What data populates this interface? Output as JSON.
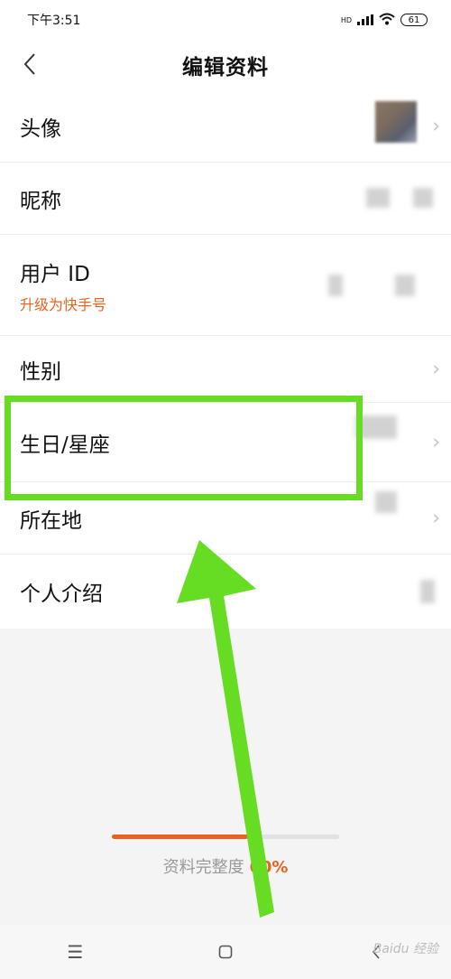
{
  "status_bar": {
    "time": "下午3:51",
    "hd_label": "HD",
    "battery": "61"
  },
  "header": {
    "title": "编辑资料"
  },
  "rows": [
    {
      "label": "头像"
    },
    {
      "label": "昵称"
    },
    {
      "label": "用户 ID",
      "sub": "升级为快手号"
    },
    {
      "label": "性别"
    },
    {
      "label": "生日/星座"
    },
    {
      "label": "所在地"
    },
    {
      "label": "个人介绍"
    }
  ],
  "progress": {
    "label": "资料完整度",
    "percent_text": "60%",
    "value": 0.6
  },
  "watermark": "Baidu 经验",
  "colors": {
    "accent": "#e8641e",
    "annotation_green": "#66dd22"
  }
}
